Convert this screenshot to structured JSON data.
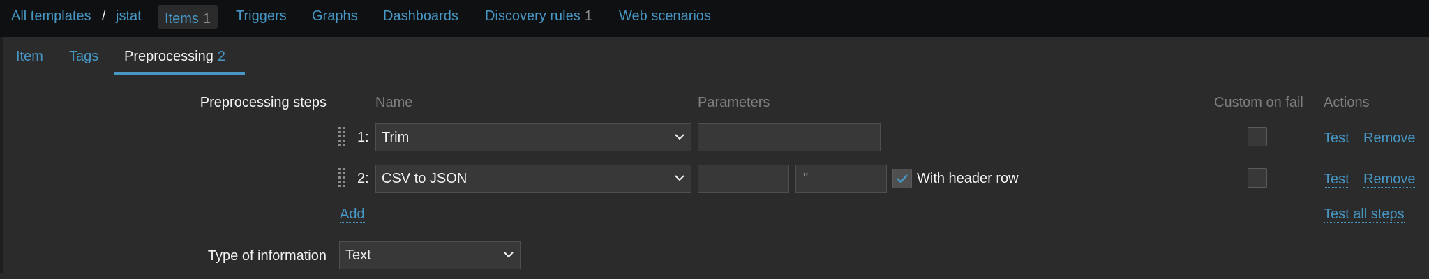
{
  "breadcrumb": {
    "all_templates": "All templates",
    "separator": "/",
    "template": "jstat"
  },
  "topnav": {
    "items": {
      "label": "Items",
      "count": "1"
    },
    "triggers": "Triggers",
    "graphs": "Graphs",
    "dashboards": "Dashboards",
    "discovery": {
      "label": "Discovery rules",
      "count": "1"
    },
    "web": "Web scenarios"
  },
  "tabs": {
    "item": "Item",
    "tags": "Tags",
    "preprocessing": {
      "label": "Preprocessing",
      "count": "2"
    }
  },
  "form": {
    "steps_label": "Preprocessing steps",
    "headers": {
      "name": "Name",
      "parameters": "Parameters",
      "custom_on_fail": "Custom on fail",
      "actions": "Actions"
    },
    "steps": [
      {
        "number": "1:",
        "name": "Trim",
        "param1": "",
        "custom_on_fail": false,
        "test": "Test",
        "remove": "Remove"
      },
      {
        "number": "2:",
        "name": "CSV to JSON",
        "param1": "",
        "param2": "\"",
        "with_header_row": true,
        "with_header_label": "With header row",
        "custom_on_fail": false,
        "test": "Test",
        "remove": "Remove"
      }
    ],
    "add": "Add",
    "test_all": "Test all steps",
    "type_label": "Type of information",
    "type_value": "Text"
  },
  "colors": {
    "background": "#2b2b2b",
    "topbar": "#0e1012",
    "link": "#4796c4",
    "field": "#383838"
  }
}
